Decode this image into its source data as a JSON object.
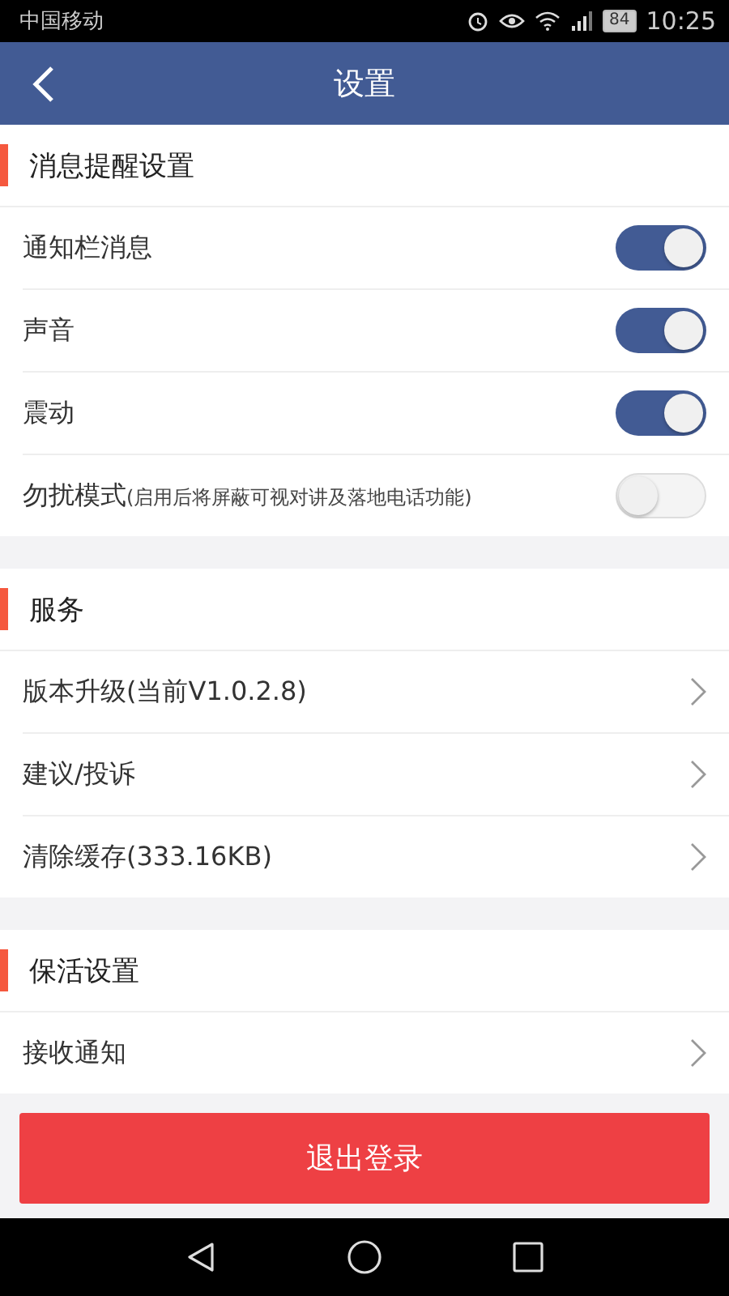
{
  "status_bar": {
    "carrier": "中国移动",
    "battery": "84",
    "time": "10:25"
  },
  "header": {
    "title": "设置"
  },
  "sections": [
    {
      "title": "消息提醒设置",
      "items": [
        {
          "kind": "toggle",
          "label": "通知栏消息",
          "on": true
        },
        {
          "kind": "toggle",
          "label": "声音",
          "on": true
        },
        {
          "kind": "toggle",
          "label": "震动",
          "on": true
        },
        {
          "kind": "toggle",
          "label": "勿扰模式",
          "note": "(启用后将屏蔽可视对讲及落地电话功能)",
          "on": false
        }
      ]
    },
    {
      "title": "服务",
      "items": [
        {
          "kind": "link",
          "label": "版本升级(当前V1.0.2.8)"
        },
        {
          "kind": "link",
          "label": "建议/投诉"
        },
        {
          "kind": "link",
          "label": "清除缓存(333.16KB)"
        }
      ]
    },
    {
      "title": "保活设置",
      "items": [
        {
          "kind": "link",
          "label": "接收通知"
        }
      ]
    }
  ],
  "logout_button": "退出登录"
}
